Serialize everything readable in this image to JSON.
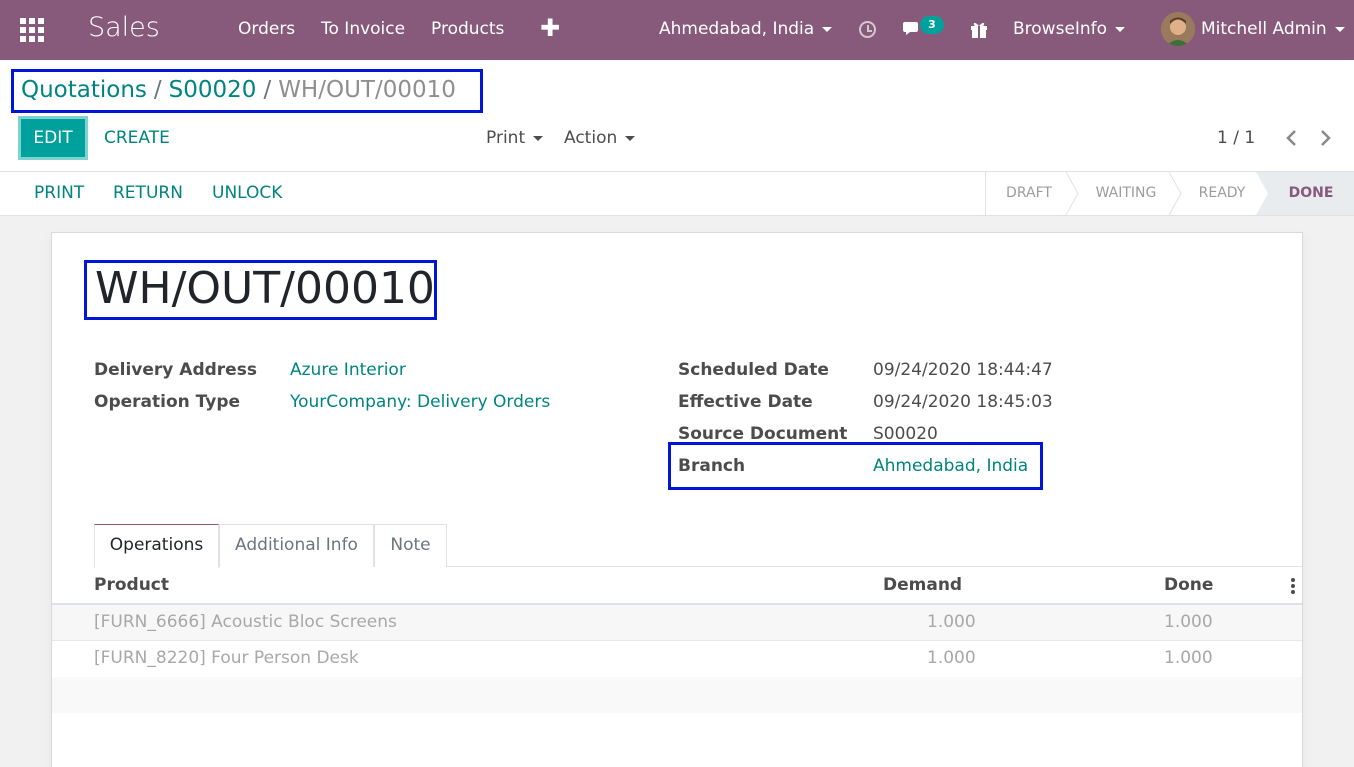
{
  "navbar": {
    "app_name": "Sales",
    "menu": [
      "Orders",
      "To Invoice",
      "Products"
    ],
    "plus": "✚",
    "branch": "Ahmedabad, India",
    "message_count": "3",
    "company": "BrowseInfo",
    "user": "Mitchell Admin",
    "color": "#875a7b"
  },
  "breadcrumb": {
    "items": [
      "Quotations",
      "S00020"
    ],
    "separator": "/",
    "current": "WH/OUT/00010"
  },
  "toolbar": {
    "edit": "EDIT",
    "create": "CREATE",
    "print": "Print",
    "action": "Action",
    "pager": "1 / 1"
  },
  "statusbar": {
    "buttons": [
      "PRINT",
      "RETURN",
      "UNLOCK"
    ],
    "stages": [
      "DRAFT",
      "WAITING",
      "READY",
      "DONE"
    ],
    "active_stage": "DONE"
  },
  "record": {
    "title": "WH/OUT/00010",
    "left_fields": [
      {
        "label": "Delivery Address",
        "value": "Azure Interior"
      },
      {
        "label": "Operation Type",
        "value": "YourCompany: Delivery Orders"
      }
    ],
    "right_fields": [
      {
        "label": "Scheduled Date",
        "value": "09/24/2020 18:44:47"
      },
      {
        "label": "Effective Date",
        "value": "09/24/2020 18:45:03"
      },
      {
        "label": "Source Document",
        "value": "S00020"
      },
      {
        "label": "Branch",
        "value": "Ahmedabad, India"
      }
    ]
  },
  "tabs": [
    "Operations",
    "Additional Info",
    "Note"
  ],
  "table": {
    "headers": [
      "Product",
      "Demand",
      "Done"
    ],
    "rows": [
      {
        "product": "[FURN_6666] Acoustic Bloc Screens",
        "demand": "1.000",
        "done": "1.000"
      },
      {
        "product": "[FURN_8220] Four Person Desk",
        "demand": "1.000",
        "done": "1.000"
      }
    ]
  },
  "icons": {
    "apps": "apps-grid-icon",
    "activity": "clock-icon",
    "messages": "chat-icon",
    "gift": "gift-icon",
    "more": "kebab-icon"
  },
  "colors": {
    "accent": "#00a09d",
    "link": "#00847f",
    "highlight_box": "#0015d6"
  }
}
